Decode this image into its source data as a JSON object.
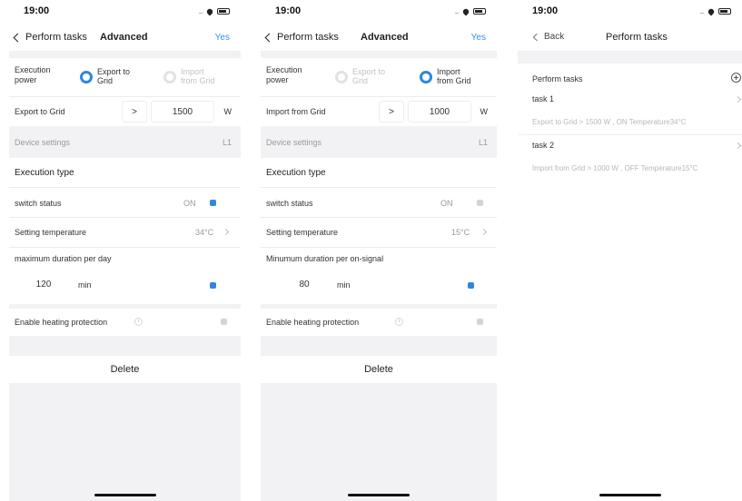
{
  "status_time": "19:00",
  "colors": {
    "accent": "#2f86e6",
    "bg": "#f2f2f4"
  },
  "screen1": {
    "back_label": "Perform tasks",
    "title": "Advanced",
    "confirm_label": "Yes",
    "execution_power_label": "Execution power",
    "option_export": "Export to Grid",
    "option_import": "Import from Grid",
    "selected_option": "Export to Grid",
    "grid_label": "Export to Grid",
    "comparator": ">",
    "grid_value": "1500",
    "grid_unit": "W",
    "device_settings_label": "Device settings",
    "device_settings_value": "L1",
    "execution_type_label": "Execution type",
    "switch_status_label": "switch status",
    "switch_status_value": "ON",
    "setting_temperature_label": "Setting temperature",
    "setting_temperature_value": "34°C",
    "duration_label": "maximum duration per day",
    "duration_value": "120",
    "duration_unit": "min",
    "heating_protection_label": "Enable heating protection",
    "delete_label": "Delete"
  },
  "screen2": {
    "back_label": "Perform tasks",
    "title": "Advanced",
    "confirm_label": "Yes",
    "execution_power_label": "Execution power",
    "option_export": "Export to Grid",
    "option_import": "Import from Grid",
    "selected_option": "Import from Grid",
    "grid_label": "Import from Grid",
    "comparator": ">",
    "grid_value": "1000",
    "grid_unit": "W",
    "device_settings_label": "Device settings",
    "device_settings_value": "L1",
    "execution_type_label": "Execution type",
    "switch_status_label": "switch status",
    "switch_status_value": "ON",
    "setting_temperature_label": "Setting temperature",
    "setting_temperature_value": "15°C",
    "duration_label": "Minumum duration per on-signal",
    "duration_value": "80",
    "duration_unit": "min",
    "heating_protection_label": "Enable heating protection",
    "delete_label": "Delete"
  },
  "screen3": {
    "back_label": "Back",
    "title": "Perform tasks",
    "section_label": "Perform tasks",
    "tasks": [
      {
        "name": "task 1",
        "summary": "Export to Grid > 1500 W , ON Temperature34°C"
      },
      {
        "name": "task 2",
        "summary": "Import from Grid > 1000 W , OFF Temperature15°C"
      }
    ]
  }
}
